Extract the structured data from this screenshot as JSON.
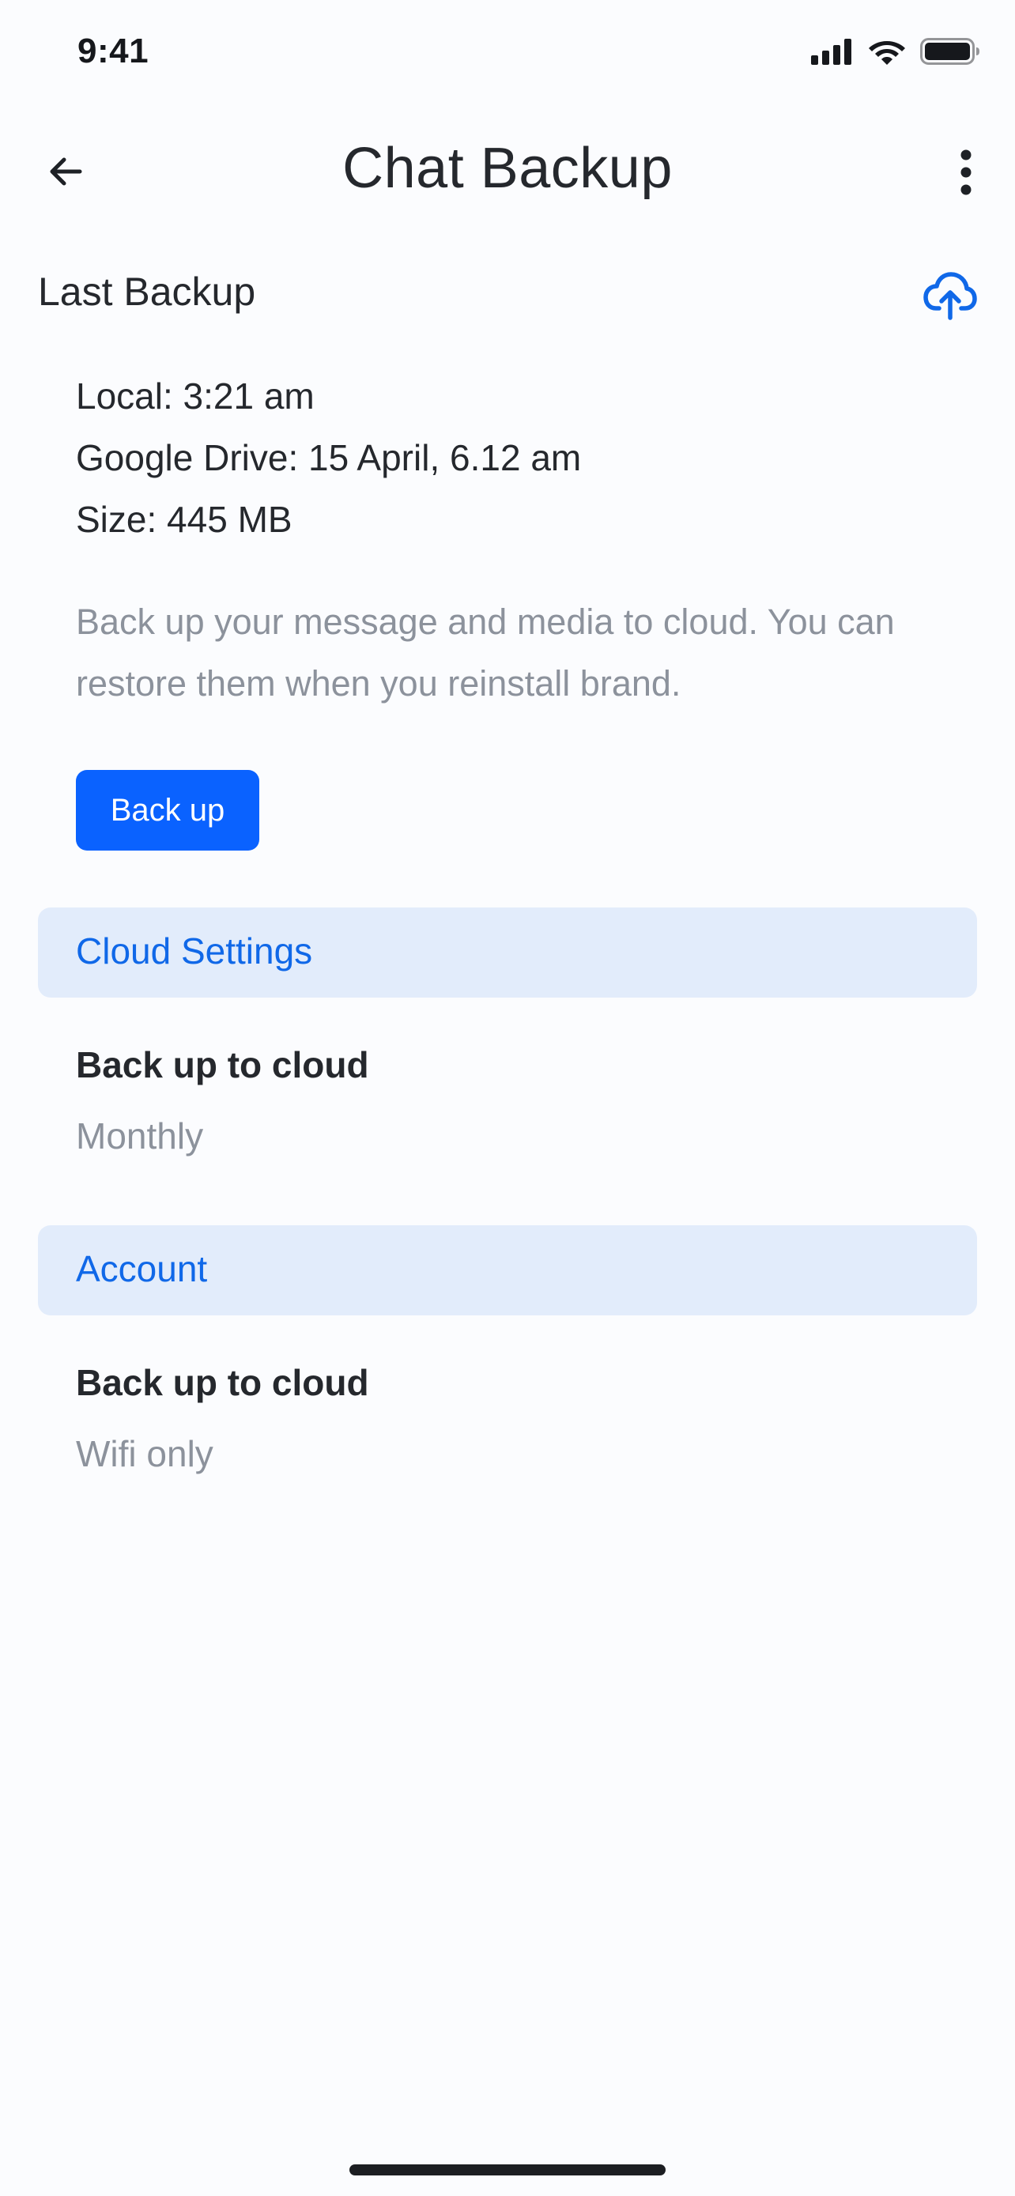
{
  "status_bar": {
    "time": "9:41"
  },
  "header": {
    "title": "Chat Backup",
    "back_icon": "arrow-left-icon",
    "more_icon": "more-vertical-icon"
  },
  "last_backup": {
    "heading": "Last Backup",
    "upload_icon": "cloud-upload-icon",
    "local": "Local: 3:21 am",
    "google_drive": "Google Drive: 15 April, 6.12 am",
    "size": "Size: 445 MB",
    "description": "Back up your message and media to cloud. You can restore them when you reinstall brand.",
    "button_label": "Back up"
  },
  "cloud_settings": {
    "label": "Cloud Settings",
    "item": {
      "title": "Back up to cloud",
      "value": "Monthly"
    }
  },
  "account": {
    "label": "Account",
    "item": {
      "title": "Back up to cloud",
      "value": "Wifi only"
    }
  },
  "colors": {
    "accent": "#0A62FF",
    "group_bg": "#E2ECFB",
    "group_text": "#1068E8",
    "muted_text": "#8C929C",
    "background": "#FBFCFE"
  }
}
